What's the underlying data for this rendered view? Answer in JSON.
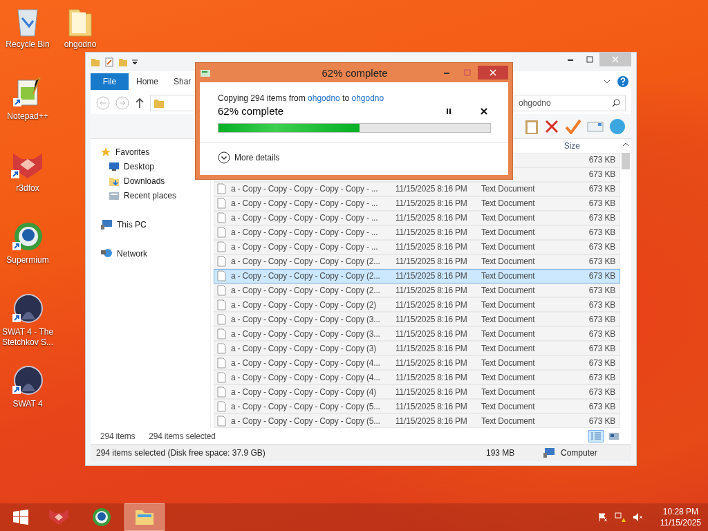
{
  "desktop_icons": [
    {
      "label": "Recycle Bin",
      "kind": "recycle"
    },
    {
      "label": "ohgodno",
      "kind": "folder"
    },
    {
      "label": "Notepad++",
      "kind": "notepad"
    },
    {
      "label": "r3dfox",
      "kind": "fox"
    },
    {
      "label": "Supermium",
      "kind": "browser"
    },
    {
      "label": "SWAT 4 - The Stetchkov S...",
      "kind": "game"
    },
    {
      "label": "SWAT 4",
      "kind": "game"
    }
  ],
  "explorer": {
    "ribbon_tabs": [
      {
        "label": "File",
        "kind": "file"
      },
      {
        "label": "Home",
        "kind": "tab"
      },
      {
        "label": "Shar",
        "kind": "tab"
      }
    ],
    "search": {
      "placeholder": "ohgodno"
    },
    "sidebar": [
      {
        "label": "Favorites",
        "kind": "star",
        "children": [
          {
            "label": "Desktop",
            "kind": "desktop"
          },
          {
            "label": "Downloads",
            "kind": "downloads"
          },
          {
            "label": "Recent places",
            "kind": "recent"
          }
        ]
      },
      {
        "label": "This PC",
        "kind": "pc"
      },
      {
        "label": "Network",
        "kind": "network"
      }
    ],
    "columns": [
      {
        "label": "Size"
      }
    ],
    "rows": [
      {
        "kind": "partial",
        "size": "673 KB",
        "selected": false
      },
      {
        "kind": "partial",
        "size": "673 KB",
        "selected": false
      },
      {
        "kind": "file",
        "name": "a - Copy - Copy - Copy - Copy - Copy - ...",
        "date": "11/15/2025 8:16 PM",
        "type": "Text Document",
        "size": "673 KB",
        "selected": false
      },
      {
        "kind": "file",
        "name": "a - Copy - Copy - Copy - Copy - Copy - ...",
        "date": "11/15/2025 8:16 PM",
        "type": "Text Document",
        "size": "673 KB",
        "selected": false
      },
      {
        "kind": "file",
        "name": "a - Copy - Copy - Copy - Copy - Copy - ...",
        "date": "11/15/2025 8:16 PM",
        "type": "Text Document",
        "size": "673 KB",
        "selected": false
      },
      {
        "kind": "file",
        "name": "a - Copy - Copy - Copy - Copy - Copy - ...",
        "date": "11/15/2025 8:16 PM",
        "type": "Text Document",
        "size": "673 KB",
        "selected": false
      },
      {
        "kind": "file",
        "name": "a - Copy - Copy - Copy - Copy - Copy - ...",
        "date": "11/15/2025 8:16 PM",
        "type": "Text Document",
        "size": "673 KB",
        "selected": false
      },
      {
        "kind": "file",
        "name": "a - Copy - Copy - Copy - Copy - Copy (2...",
        "date": "11/15/2025 8:16 PM",
        "type": "Text Document",
        "size": "673 KB",
        "selected": false
      },
      {
        "kind": "file",
        "name": "a - Copy - Copy - Copy - Copy - Copy (2...",
        "date": "11/15/2025 8:16 PM",
        "type": "Text Document",
        "size": "673 KB",
        "selected": true
      },
      {
        "kind": "file",
        "name": "a - Copy - Copy - Copy - Copy - Copy (2...",
        "date": "11/15/2025 8:16 PM",
        "type": "Text Document",
        "size": "673 KB",
        "selected": false
      },
      {
        "kind": "file",
        "name": "a - Copy - Copy - Copy - Copy - Copy (2)",
        "date": "11/15/2025 8:16 PM",
        "type": "Text Document",
        "size": "673 KB",
        "selected": false
      },
      {
        "kind": "file",
        "name": "a - Copy - Copy - Copy - Copy - Copy (3...",
        "date": "11/15/2025 8:16 PM",
        "type": "Text Document",
        "size": "673 KB",
        "selected": false
      },
      {
        "kind": "file",
        "name": "a - Copy - Copy - Copy - Copy - Copy (3...",
        "date": "11/15/2025 8:16 PM",
        "type": "Text Document",
        "size": "673 KB",
        "selected": false
      },
      {
        "kind": "file",
        "name": "a - Copy - Copy - Copy - Copy - Copy (3)",
        "date": "11/15/2025 8:16 PM",
        "type": "Text Document",
        "size": "673 KB",
        "selected": false
      },
      {
        "kind": "file",
        "name": "a - Copy - Copy - Copy - Copy - Copy (4...",
        "date": "11/15/2025 8:16 PM",
        "type": "Text Document",
        "size": "673 KB",
        "selected": false
      },
      {
        "kind": "file",
        "name": "a - Copy - Copy - Copy - Copy - Copy (4...",
        "date": "11/15/2025 8:16 PM",
        "type": "Text Document",
        "size": "673 KB",
        "selected": false
      },
      {
        "kind": "file",
        "name": "a - Copy - Copy - Copy - Copy - Copy (4)",
        "date": "11/15/2025 8:16 PM",
        "type": "Text Document",
        "size": "673 KB",
        "selected": false
      },
      {
        "kind": "file",
        "name": "a - Copy - Copy - Copy - Copy - Copy (5...",
        "date": "11/15/2025 8:16 PM",
        "type": "Text Document",
        "size": "673 KB",
        "selected": false
      },
      {
        "kind": "file",
        "name": "a - Copy - Copy - Copy - Copy - Copy (5...",
        "date": "11/15/2025 8:16 PM",
        "type": "Text Document",
        "size": "673 KB",
        "selected": false
      }
    ],
    "item_count": "294 items",
    "selection_count": "294 items selected",
    "views": [
      {
        "kind": "details",
        "selected": true
      },
      {
        "kind": "tiles",
        "selected": false
      }
    ],
    "status_bar": {
      "selection": "294 items selected (Disk free space: 37.9 GB)",
      "size": "193 MB",
      "location": "Computer"
    }
  },
  "copy_dialog": {
    "title": "62% complete",
    "prefix": "Copying 294 items from",
    "source": "ohgodno",
    "middle": "to",
    "destination": "ohgodno",
    "percent": "62% complete",
    "level": 0.52,
    "details_label": "More details"
  },
  "taskbar": {
    "apps": [
      {
        "kind": "fox",
        "selected": false
      },
      {
        "kind": "browser",
        "selected": false
      },
      {
        "kind": "explorer",
        "selected": true
      }
    ],
    "tray": [
      {
        "kind": "flag"
      },
      {
        "kind": "network"
      },
      {
        "kind": "volume"
      }
    ],
    "time": "10:28 PM",
    "date": "11/15/2025"
  }
}
